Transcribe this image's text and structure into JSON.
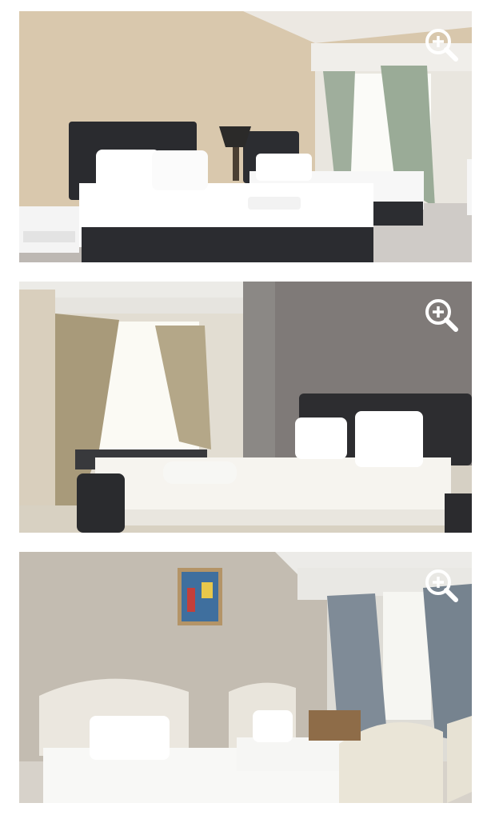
{
  "gallery": {
    "photos": [
      {
        "name": "room-photo-1",
        "zoom_icon": "zoom-in-icon"
      },
      {
        "name": "room-photo-2",
        "zoom_icon": "zoom-in-icon"
      },
      {
        "name": "room-photo-3",
        "zoom_icon": "zoom-in-icon"
      }
    ]
  },
  "colors": {
    "background": "#ffffff",
    "zoom_icon": "#ffffff"
  }
}
